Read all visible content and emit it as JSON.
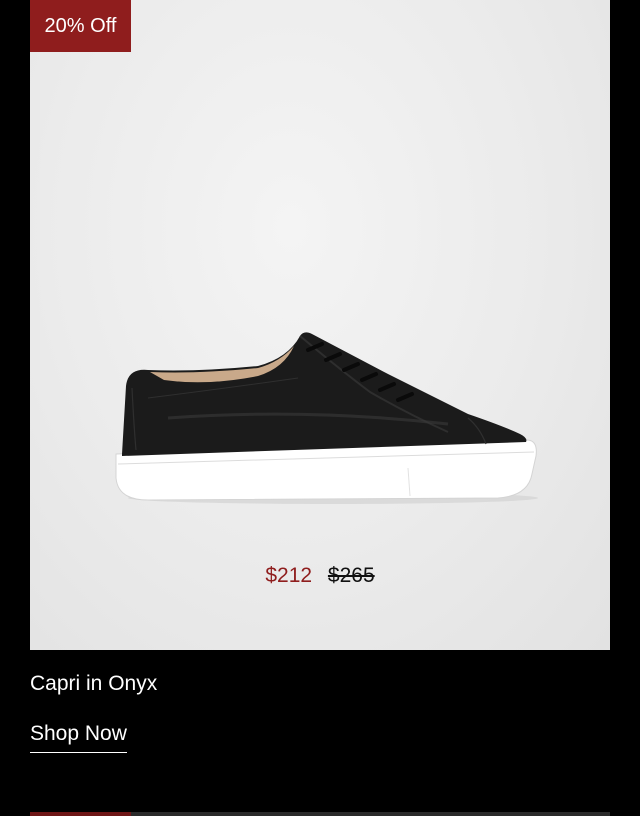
{
  "product": {
    "badge": "20% Off",
    "name": "Capri in Onyx",
    "sale_price": "$212",
    "original_price": "$265",
    "image_icon": "black-leather-sneaker"
  },
  "cta": {
    "shop_now_label": "Shop Now"
  },
  "colors": {
    "background": "#000000",
    "badge": "#8f1d1d",
    "sale_price": "#8f1d1d",
    "image_backdrop": "#ebebeb"
  }
}
